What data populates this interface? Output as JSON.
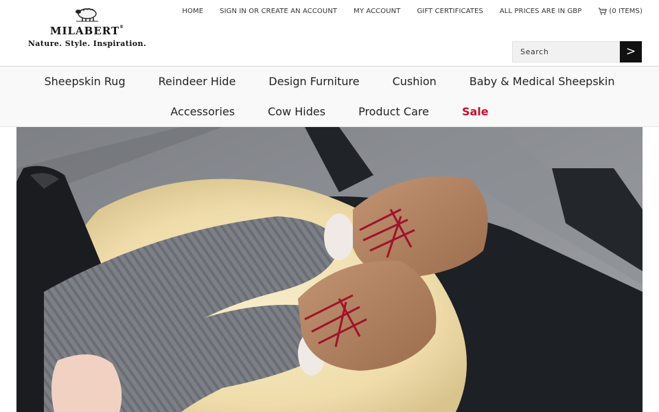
{
  "brand": {
    "name": "MILABERT",
    "registered": "®",
    "tagline": "Nature. Style. Inspiration."
  },
  "topnav": {
    "home": "HOME",
    "signin": "SIGN IN OR CREATE AN ACCOUNT",
    "account": "MY ACCOUNT",
    "gift": "GIFT CERTIFICATES",
    "currency": "ALL PRICES ARE IN GBP",
    "cart": "(0 ITEMS)",
    "cart_icon": "cart-icon"
  },
  "search": {
    "placeholder": "Search",
    "button": ">"
  },
  "categories": {
    "row1": [
      "Sheepskin Rug",
      "Reindeer Hide",
      "Design Furniture",
      "Cushion",
      "Baby & Medical Sheepskin"
    ],
    "row2": [
      "Accessories",
      "Cow Hides",
      "Product Care",
      "Sale"
    ]
  },
  "colors": {
    "sale": "#c8102e",
    "search_button": "#111111",
    "nav_background": "#f9f9f9"
  }
}
